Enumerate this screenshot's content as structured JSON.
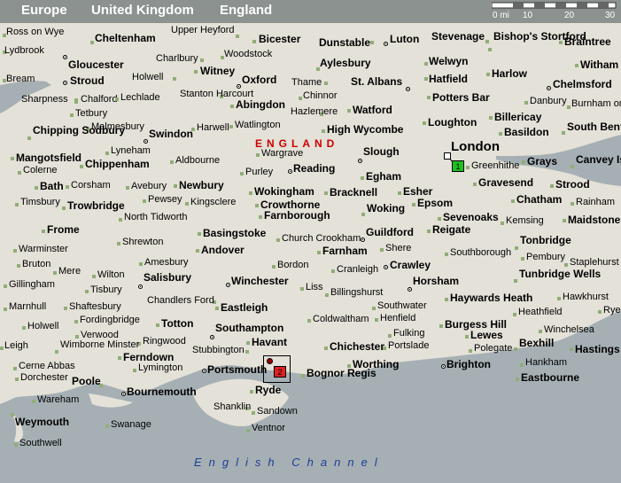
{
  "breadcrumb": [
    "Europe",
    "United Kingdom",
    "England"
  ],
  "scale": {
    "labels": [
      "0 mi",
      "10",
      "20",
      "30"
    ]
  },
  "region_label": "ENGLAND",
  "sea_label": "English Channel",
  "colors": {
    "land": "#e4e1d8",
    "sea": "#a6b0b4",
    "header": "#8c9290",
    "region": "#c00000",
    "sea_text": "#1c3e96",
    "marker1": "#1ec01e",
    "marker2": "#e02020"
  },
  "markers": [
    {
      "number": "1",
      "place": "London"
    },
    {
      "number": "2",
      "place": "Portsmouth"
    }
  ],
  "places": [
    {
      "name": "Ross on Wye",
      "size": "small"
    },
    {
      "name": "Cheltenham",
      "size": "medium"
    },
    {
      "name": "Upper Heyford",
      "size": "small"
    },
    {
      "name": "Bicester",
      "size": "medium"
    },
    {
      "name": "Dunstable",
      "size": "medium"
    },
    {
      "name": "Luton",
      "size": "medium"
    },
    {
      "name": "Stevenage",
      "size": "medium"
    },
    {
      "name": "Bishop's Stortford",
      "size": "medium"
    },
    {
      "name": "Braintree",
      "size": "medium"
    },
    {
      "name": "Lydbrook",
      "size": "small"
    },
    {
      "name": "Woodstock",
      "size": "small"
    },
    {
      "name": "Gloucester",
      "size": "medium"
    },
    {
      "name": "Charlbury",
      "size": "small"
    },
    {
      "name": "Aylesbury",
      "size": "medium"
    },
    {
      "name": "Welwyn",
      "size": "medium"
    },
    {
      "name": "Witham",
      "size": "medium"
    },
    {
      "name": "Witney",
      "size": "medium"
    },
    {
      "name": "Harlow",
      "size": "medium"
    },
    {
      "name": "Bream",
      "size": "small"
    },
    {
      "name": "Stroud",
      "size": "medium"
    },
    {
      "name": "Holwell",
      "size": "small"
    },
    {
      "name": "Oxford",
      "size": "medium"
    },
    {
      "name": "Thame",
      "size": "small"
    },
    {
      "name": "St. Albans",
      "size": "medium"
    },
    {
      "name": "Hatfield",
      "size": "medium"
    },
    {
      "name": "Chelmsford",
      "size": "medium"
    },
    {
      "name": "Sharpness",
      "size": "small"
    },
    {
      "name": "Chalford",
      "size": "small"
    },
    {
      "name": "Lechlade",
      "size": "small"
    },
    {
      "name": "Stanton Harcourt",
      "size": "small"
    },
    {
      "name": "Chinnor",
      "size": "small"
    },
    {
      "name": "Potters Bar",
      "size": "medium"
    },
    {
      "name": "Danbury",
      "size": "small"
    },
    {
      "name": "Abingdon",
      "size": "medium"
    },
    {
      "name": "Watford",
      "size": "medium"
    },
    {
      "name": "Burnham on Crouch",
      "size": "small"
    },
    {
      "name": "Tetbury",
      "size": "small"
    },
    {
      "name": "Hazlemere",
      "size": "small"
    },
    {
      "name": "Billericay",
      "size": "medium"
    },
    {
      "name": "Malmesbury",
      "size": "small"
    },
    {
      "name": "Watlington",
      "size": "small"
    },
    {
      "name": "Loughton",
      "size": "medium"
    },
    {
      "name": "Chipping Sodbury",
      "size": "medium"
    },
    {
      "name": "Harwell",
      "size": "small"
    },
    {
      "name": "High Wycombe",
      "size": "medium"
    },
    {
      "name": "Basildon",
      "size": "medium"
    },
    {
      "name": "South Benfleet",
      "size": "medium"
    },
    {
      "name": "Swindon",
      "size": "medium"
    },
    {
      "name": "London",
      "size": "large"
    },
    {
      "name": "Lyneham",
      "size": "small"
    },
    {
      "name": "Wargrave",
      "size": "small"
    },
    {
      "name": "Slough",
      "size": "medium"
    },
    {
      "name": "Mangotsfield",
      "size": "medium"
    },
    {
      "name": "Aldbourne",
      "size": "small"
    },
    {
      "name": "Greenhithe",
      "size": "small"
    },
    {
      "name": "Grays",
      "size": "medium"
    },
    {
      "name": "Canvey Island",
      "size": "medium"
    },
    {
      "name": "Chippenham",
      "size": "medium"
    },
    {
      "name": "Purley",
      "size": "small"
    },
    {
      "name": "Reading",
      "size": "medium"
    },
    {
      "name": "Colerne",
      "size": "small"
    },
    {
      "name": "Egham",
      "size": "medium"
    },
    {
      "name": "Gravesend",
      "size": "medium"
    },
    {
      "name": "Bath",
      "size": "medium"
    },
    {
      "name": "Corsham",
      "size": "small"
    },
    {
      "name": "Avebury",
      "size": "small"
    },
    {
      "name": "Newbury",
      "size": "medium"
    },
    {
      "name": "Wokingham",
      "size": "medium"
    },
    {
      "name": "Bracknell",
      "size": "medium"
    },
    {
      "name": "Esher",
      "size": "medium"
    },
    {
      "name": "Strood",
      "size": "medium"
    },
    {
      "name": "Pewsey",
      "size": "small"
    },
    {
      "name": "Chatham",
      "size": "medium"
    },
    {
      "name": "Timsbury",
      "size": "small"
    },
    {
      "name": "Trowbridge",
      "size": "medium"
    },
    {
      "name": "Kingsclere",
      "size": "small"
    },
    {
      "name": "Crowthorne",
      "size": "medium"
    },
    {
      "name": "Woking",
      "size": "medium"
    },
    {
      "name": "Epsom",
      "size": "medium"
    },
    {
      "name": "Rainham",
      "size": "small"
    },
    {
      "name": "Farnborough",
      "size": "medium"
    },
    {
      "name": "Sevenoaks",
      "size": "medium"
    },
    {
      "name": "Maidstone",
      "size": "medium"
    },
    {
      "name": "North Tidworth",
      "size": "small"
    },
    {
      "name": "Kemsing",
      "size": "small"
    },
    {
      "name": "Frome",
      "size": "medium"
    },
    {
      "name": "Basingstoke",
      "size": "medium"
    },
    {
      "name": "Guildford",
      "size": "medium"
    },
    {
      "name": "Reigate",
      "size": "medium"
    },
    {
      "name": "Church Crookham",
      "size": "small"
    },
    {
      "name": "Shrewton",
      "size": "small"
    },
    {
      "name": "Tonbridge",
      "size": "medium"
    },
    {
      "name": "Warminster",
      "size": "small"
    },
    {
      "name": "Andover",
      "size": "medium"
    },
    {
      "name": "Farnham",
      "size": "medium"
    },
    {
      "name": "Shere",
      "size": "small"
    },
    {
      "name": "Southborough",
      "size": "small"
    },
    {
      "name": "Pembury",
      "size": "small"
    },
    {
      "name": "Amesbury",
      "size": "small"
    },
    {
      "name": "Bruton",
      "size": "small"
    },
    {
      "name": "Bordon",
      "size": "small"
    },
    {
      "name": "Crawley",
      "size": "medium"
    },
    {
      "name": "Staplehurst",
      "size": "small"
    },
    {
      "name": "Mere",
      "size": "small"
    },
    {
      "name": "Wilton",
      "size": "small"
    },
    {
      "name": "Cranleigh",
      "size": "small"
    },
    {
      "name": "Tunbridge Wells",
      "size": "medium"
    },
    {
      "name": "Gillingham",
      "size": "small"
    },
    {
      "name": "Salisbury",
      "size": "medium"
    },
    {
      "name": "Winchester",
      "size": "medium"
    },
    {
      "name": "Horsham",
      "size": "medium"
    },
    {
      "name": "Tisbury",
      "size": "small"
    },
    {
      "name": "Liss",
      "size": "small"
    },
    {
      "name": "Billingshurst",
      "size": "small"
    },
    {
      "name": "Hawkhurst",
      "size": "small"
    },
    {
      "name": "Chandlers Ford",
      "size": "small"
    },
    {
      "name": "Haywards Heath",
      "size": "medium"
    },
    {
      "name": "Marnhull",
      "size": "small"
    },
    {
      "name": "Shaftesbury",
      "size": "small"
    },
    {
      "name": "Eastleigh",
      "size": "medium"
    },
    {
      "name": "Southwater",
      "size": "small"
    },
    {
      "name": "Rye",
      "size": "small"
    },
    {
      "name": "Fordingbridge",
      "size": "small"
    },
    {
      "name": "Heathfield",
      "size": "small"
    },
    {
      "name": "Coldwaltham",
      "size": "small"
    },
    {
      "name": "Henfield",
      "size": "small"
    },
    {
      "name": "Holwell",
      "size": "small"
    },
    {
      "name": "Totton",
      "size": "medium"
    },
    {
      "name": "Southampton",
      "size": "medium"
    },
    {
      "name": "Burgess Hill",
      "size": "medium"
    },
    {
      "name": "Winchelsea",
      "size": "small"
    },
    {
      "name": "Verwood",
      "size": "small"
    },
    {
      "name": "Lewes",
      "size": "medium"
    },
    {
      "name": "Fulking",
      "size": "small"
    },
    {
      "name": "Bexhill",
      "size": "medium"
    },
    {
      "name": "Ringwood",
      "size": "small"
    },
    {
      "name": "Havant",
      "size": "medium"
    },
    {
      "name": "Leigh",
      "size": "small"
    },
    {
      "name": "Wimborne Minster",
      "size": "small"
    },
    {
      "name": "Chichester",
      "size": "medium"
    },
    {
      "name": "Portslade",
      "size": "small"
    },
    {
      "name": "Hastings",
      "size": "medium"
    },
    {
      "name": "Stubbington",
      "size": "small"
    },
    {
      "name": "Polegate",
      "size": "small"
    },
    {
      "name": "Ferndown",
      "size": "medium"
    },
    {
      "name": "Cerne Abbas",
      "size": "small"
    },
    {
      "name": "Lymington",
      "size": "small"
    },
    {
      "name": "Portsmouth",
      "size": "medium"
    },
    {
      "name": "Worthing",
      "size": "medium"
    },
    {
      "name": "Brighton",
      "size": "medium"
    },
    {
      "name": "Hankham",
      "size": "small"
    },
    {
      "name": "Dorchester",
      "size": "small"
    },
    {
      "name": "Poole",
      "size": "medium"
    },
    {
      "name": "Bognor Regis",
      "size": "medium"
    },
    {
      "name": "Eastbourne",
      "size": "medium"
    },
    {
      "name": "Bournemouth",
      "size": "medium"
    },
    {
      "name": "Ryde",
      "size": "medium"
    },
    {
      "name": "Wareham",
      "size": "small"
    },
    {
      "name": "Shanklin",
      "size": "small"
    },
    {
      "name": "Sandown",
      "size": "small"
    },
    {
      "name": "Weymouth",
      "size": "medium"
    },
    {
      "name": "Swanage",
      "size": "small"
    },
    {
      "name": "Ventnor",
      "size": "small"
    },
    {
      "name": "Southwell",
      "size": "small"
    }
  ]
}
